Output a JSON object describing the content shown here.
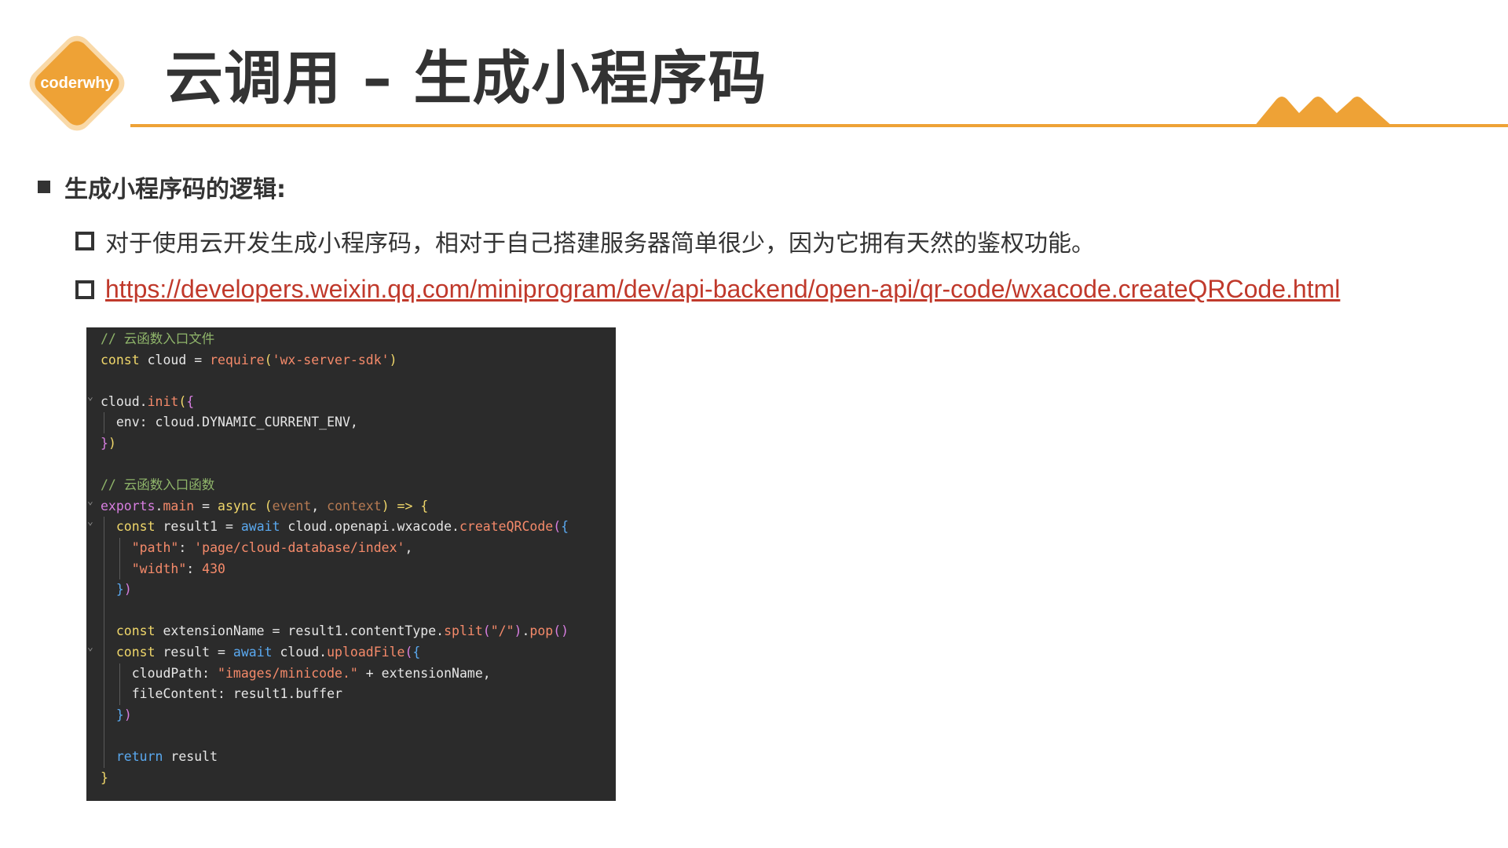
{
  "logo": {
    "text": "coderwhy"
  },
  "title": "云调用 – 生成小程序码",
  "colors": {
    "accent": "#eea236",
    "text": "#333333",
    "link": "#c0392b",
    "code_bg": "#2b2b2b"
  },
  "section": {
    "heading": "生成小程序码的逻辑:"
  },
  "items": [
    {
      "text": "对于使用云开发生成小程序码，相对于自己搭建服务器简单很少，因为它拥有天然的鉴权功能。"
    },
    {
      "link": "https://developers.weixin.qq.com/miniprogram/dev/api-backend/open-api/qr-code/wxacode.createQRCode.html"
    }
  ],
  "code": {
    "lines": [
      [
        {
          "t": "// 云函数入口文件",
          "c": "comment"
        }
      ],
      [
        {
          "t": "const",
          "c": "keyword"
        },
        {
          "t": " cloud = ",
          "c": "plain"
        },
        {
          "t": "require",
          "c": "func"
        },
        {
          "t": "(",
          "c": "paren-y"
        },
        {
          "t": "'wx-server-sdk'",
          "c": "string"
        },
        {
          "t": ")",
          "c": "paren-y"
        }
      ],
      [],
      [
        {
          "t": "cloud.",
          "c": "plain"
        },
        {
          "t": "init",
          "c": "func"
        },
        {
          "t": "(",
          "c": "paren-y"
        },
        {
          "t": "{",
          "c": "paren-p"
        }
      ],
      [
        {
          "t": "  env: cloud.DYNAMIC_CURRENT_ENV,",
          "c": "plain"
        }
      ],
      [
        {
          "t": "}",
          "c": "paren-p"
        },
        {
          "t": ")",
          "c": "paren-y"
        }
      ],
      [],
      [
        {
          "t": "// 云函数入口函数",
          "c": "comment"
        }
      ],
      [
        {
          "t": "exports",
          "c": "export"
        },
        {
          "t": ".",
          "c": "plain"
        },
        {
          "t": "main",
          "c": "prop"
        },
        {
          "t": " = ",
          "c": "plain"
        },
        {
          "t": "async",
          "c": "keyword"
        },
        {
          "t": " ",
          "c": "plain"
        },
        {
          "t": "(",
          "c": "paren-y"
        },
        {
          "t": "event",
          "c": "param"
        },
        {
          "t": ", ",
          "c": "plain"
        },
        {
          "t": "context",
          "c": "param"
        },
        {
          "t": ")",
          "c": "paren-y"
        },
        {
          "t": " => ",
          "c": "keyword"
        },
        {
          "t": "{",
          "c": "paren-y"
        }
      ],
      [
        {
          "t": "  ",
          "c": "plain"
        },
        {
          "t": "const",
          "c": "keyword"
        },
        {
          "t": " result1 = ",
          "c": "plain"
        },
        {
          "t": "await",
          "c": "await"
        },
        {
          "t": " cloud.openapi.wxacode.",
          "c": "plain"
        },
        {
          "t": "createQRCode",
          "c": "func"
        },
        {
          "t": "(",
          "c": "paren-p"
        },
        {
          "t": "{",
          "c": "paren-b"
        }
      ],
      [
        {
          "t": "    ",
          "c": "plain"
        },
        {
          "t": "\"path\"",
          "c": "string"
        },
        {
          "t": ": ",
          "c": "plain"
        },
        {
          "t": "'page/cloud-database/index'",
          "c": "string"
        },
        {
          "t": ",",
          "c": "plain"
        }
      ],
      [
        {
          "t": "    ",
          "c": "plain"
        },
        {
          "t": "\"width\"",
          "c": "string"
        },
        {
          "t": ": ",
          "c": "plain"
        },
        {
          "t": "430",
          "c": "num"
        }
      ],
      [
        {
          "t": "  ",
          "c": "plain"
        },
        {
          "t": "}",
          "c": "paren-b"
        },
        {
          "t": ")",
          "c": "paren-p"
        }
      ],
      [],
      [
        {
          "t": "  ",
          "c": "plain"
        },
        {
          "t": "const",
          "c": "keyword"
        },
        {
          "t": " extensionName = result1.contentType.",
          "c": "plain"
        },
        {
          "t": "split",
          "c": "func"
        },
        {
          "t": "(",
          "c": "paren-p"
        },
        {
          "t": "\"/\"",
          "c": "string"
        },
        {
          "t": ")",
          "c": "paren-p"
        },
        {
          "t": ".",
          "c": "plain"
        },
        {
          "t": "pop",
          "c": "func"
        },
        {
          "t": "()",
          "c": "paren-p"
        }
      ],
      [
        {
          "t": "  ",
          "c": "plain"
        },
        {
          "t": "const",
          "c": "keyword"
        },
        {
          "t": " result = ",
          "c": "plain"
        },
        {
          "t": "await",
          "c": "await"
        },
        {
          "t": " cloud.",
          "c": "plain"
        },
        {
          "t": "uploadFile",
          "c": "func"
        },
        {
          "t": "(",
          "c": "paren-p"
        },
        {
          "t": "{",
          "c": "paren-b"
        }
      ],
      [
        {
          "t": "    cloudPath: ",
          "c": "plain"
        },
        {
          "t": "\"images/minicode.\"",
          "c": "string"
        },
        {
          "t": " + extensionName,",
          "c": "plain"
        }
      ],
      [
        {
          "t": "    fileContent: result1.buffer",
          "c": "plain"
        }
      ],
      [
        {
          "t": "  ",
          "c": "plain"
        },
        {
          "t": "}",
          "c": "paren-b"
        },
        {
          "t": ")",
          "c": "paren-p"
        }
      ],
      [],
      [
        {
          "t": "  ",
          "c": "plain"
        },
        {
          "t": "return",
          "c": "await"
        },
        {
          "t": " result",
          "c": "plain"
        }
      ],
      [
        {
          "t": "}",
          "c": "paren-y"
        }
      ]
    ]
  }
}
